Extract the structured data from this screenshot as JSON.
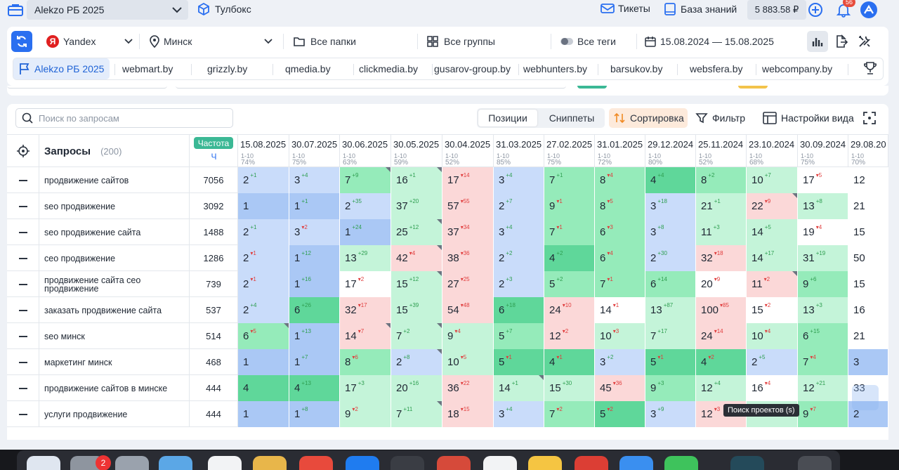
{
  "topbar": {
    "project": "Alekzo РБ 2025",
    "toolbox": "Тулбокс",
    "tickets": "Тикеты",
    "knowledge_base": "База знаний",
    "balance": "5 883.58 ₽",
    "notif_count": "56"
  },
  "filters": {
    "engine": "Yandex",
    "engine_letter": "Я",
    "region": "Минск",
    "folders": "Все папки",
    "groups": "Все группы",
    "tags": "Все теги",
    "date_range": "15.08.2024 — 15.08.2025"
  },
  "project_tabs": [
    "Alekzo РБ 2025",
    "webmart.by",
    "grizzly.by",
    "qmedia.by",
    "clickmedia.by",
    "gusarov-group.by",
    "webhunters.by",
    "barsukov.by",
    "websfera.by",
    "webcompany.by"
  ],
  "toolbar": {
    "search_placeholder": "Поиск по запросам",
    "positions": "Позиции",
    "snippets": "Сниппеты",
    "sort": "Сортировка",
    "filter": "Фильтр",
    "view_settings": "Настройки вида"
  },
  "table": {
    "queries_label": "Запросы",
    "queries_count": "(200)",
    "freq_label": "Частота",
    "freq_sub": "Ч",
    "dates": [
      {
        "date": "15.08.2025",
        "range": "1-10",
        "pct": "74%"
      },
      {
        "date": "30.07.2025",
        "range": "1-10",
        "pct": "75%"
      },
      {
        "date": "30.06.2025",
        "range": "1-10",
        "pct": "63%"
      },
      {
        "date": "30.05.2025",
        "range": "1-10",
        "pct": "59%"
      },
      {
        "date": "30.04.2025",
        "range": "1-10",
        "pct": "52%"
      },
      {
        "date": "31.03.2025",
        "range": "1-10",
        "pct": "85%"
      },
      {
        "date": "27.02.2025",
        "range": "1-10",
        "pct": "75%"
      },
      {
        "date": "31.01.2025",
        "range": "1-10",
        "pct": "72%"
      },
      {
        "date": "29.12.2024",
        "range": "1-10",
        "pct": "80%"
      },
      {
        "date": "25.11.2024",
        "range": "1-10",
        "pct": "52%"
      },
      {
        "date": "23.10.2024",
        "range": "1-10",
        "pct": "68%"
      },
      {
        "date": "30.09.2024",
        "range": "1-10",
        "pct": "75%"
      },
      {
        "date": "29.08.20",
        "range": "1-10",
        "pct": "70%"
      }
    ],
    "rows": [
      {
        "q": "продвижение сайтов",
        "f": "7056",
        "cells": [
          [
            "2",
            "+1",
            "b1"
          ],
          [
            "3",
            "+4",
            "b1"
          ],
          [
            "7",
            "+9",
            "b3"
          ],
          [
            "16",
            "+1",
            "b4"
          ],
          [
            "17",
            "-14",
            "b5"
          ],
          [
            "3",
            "+4",
            "b1"
          ],
          [
            "7",
            "+1",
            "b3"
          ],
          [
            "8",
            "-4",
            "b3"
          ],
          [
            "4",
            "+4",
            "b2"
          ],
          [
            "8",
            "+2",
            "b3"
          ],
          [
            "10",
            "+7",
            "b4"
          ],
          [
            "17",
            "-5",
            "b6"
          ],
          [
            "12",
            "",
            "b6"
          ]
        ]
      },
      {
        "q": "seo продвижение",
        "f": "3092",
        "cells": [
          [
            "1",
            "",
            "b0"
          ],
          [
            "1",
            "+1",
            "b0"
          ],
          [
            "2",
            "+35",
            "b1"
          ],
          [
            "37",
            "+20",
            "b4"
          ],
          [
            "57",
            "-55",
            "b5"
          ],
          [
            "2",
            "+7",
            "b1"
          ],
          [
            "9",
            "-1",
            "b3"
          ],
          [
            "8",
            "-5",
            "b3"
          ],
          [
            "3",
            "+18",
            "b1"
          ],
          [
            "21",
            "+1",
            "b4"
          ],
          [
            "22",
            "-9",
            "b5"
          ],
          [
            "13",
            "+8",
            "b4"
          ],
          [
            "21",
            "",
            "b6"
          ]
        ]
      },
      {
        "q": "seo продвижение сайта",
        "f": "1488",
        "cells": [
          [
            "2",
            "+1",
            "b1"
          ],
          [
            "3",
            "-2",
            "b1"
          ],
          [
            "1",
            "+24",
            "b0"
          ],
          [
            "25",
            "+12",
            "b4"
          ],
          [
            "37",
            "-34",
            "b5"
          ],
          [
            "3",
            "+4",
            "b1"
          ],
          [
            "7",
            "-1",
            "b3"
          ],
          [
            "6",
            "-3",
            "b3"
          ],
          [
            "3",
            "+8",
            "b1"
          ],
          [
            "11",
            "+3",
            "b4"
          ],
          [
            "14",
            "+5",
            "b4"
          ],
          [
            "19",
            "-4",
            "b6"
          ],
          [
            "15",
            "",
            "b6"
          ]
        ]
      },
      {
        "q": "сео продвижение",
        "f": "1286",
        "cells": [
          [
            "2",
            "-1",
            "b1"
          ],
          [
            "1",
            "+12",
            "b0"
          ],
          [
            "13",
            "+29",
            "b4"
          ],
          [
            "42",
            "-4",
            "b5"
          ],
          [
            "38",
            "-36",
            "b5"
          ],
          [
            "2",
            "+2",
            "b1"
          ],
          [
            "4",
            "+2",
            "b2"
          ],
          [
            "6",
            "-4",
            "b3"
          ],
          [
            "2",
            "+30",
            "b1"
          ],
          [
            "32",
            "-18",
            "b5"
          ],
          [
            "14",
            "+17",
            "b4"
          ],
          [
            "31",
            "+19",
            "b4"
          ],
          [
            "50",
            "",
            "b6"
          ]
        ]
      },
      {
        "q": "продвижение сайта сео продвижение",
        "f": "739",
        "cells": [
          [
            "2",
            "-1",
            "b1"
          ],
          [
            "1",
            "+16",
            "b0"
          ],
          [
            "17",
            "-2",
            "b6"
          ],
          [
            "15",
            "+12",
            "b4"
          ],
          [
            "27",
            "-25",
            "b5"
          ],
          [
            "2",
            "+3",
            "b1"
          ],
          [
            "5",
            "+2",
            "b3"
          ],
          [
            "7",
            "-1",
            "b3"
          ],
          [
            "6",
            "+14",
            "b3"
          ],
          [
            "20",
            "-9",
            "b6"
          ],
          [
            "11",
            "-2",
            "b5"
          ],
          [
            "9",
            "+6",
            "b3"
          ],
          [
            "15",
            "",
            "b6"
          ]
        ]
      },
      {
        "q": "заказать продвижение сайта",
        "f": "537",
        "cells": [
          [
            "2",
            "+4",
            "b1"
          ],
          [
            "6",
            "+26",
            "b2"
          ],
          [
            "32",
            "-17",
            "b5"
          ],
          [
            "15",
            "+39",
            "b4"
          ],
          [
            "54",
            "-48",
            "b5"
          ],
          [
            "6",
            "+18",
            "b2"
          ],
          [
            "24",
            "-10",
            "b5"
          ],
          [
            "14",
            "-1",
            "b6"
          ],
          [
            "13",
            "+87",
            "b4"
          ],
          [
            "100",
            "-85",
            "b5"
          ],
          [
            "15",
            "-2",
            "b6"
          ],
          [
            "13",
            "+3",
            "b4"
          ],
          [
            "16",
            "",
            "b6"
          ]
        ]
      },
      {
        "q": "seo минск",
        "f": "514",
        "cells": [
          [
            "6",
            "-5",
            "b3"
          ],
          [
            "1",
            "+13",
            "b0"
          ],
          [
            "14",
            "-7",
            "b5"
          ],
          [
            "7",
            "+2",
            "b4"
          ],
          [
            "9",
            "-4",
            "b4"
          ],
          [
            "5",
            "+7",
            "b3"
          ],
          [
            "12",
            "-2",
            "b5"
          ],
          [
            "10",
            "-3",
            "b4"
          ],
          [
            "7",
            "+17",
            "b4"
          ],
          [
            "24",
            "-14",
            "b5"
          ],
          [
            "10",
            "-4",
            "b4"
          ],
          [
            "6",
            "+15",
            "b3"
          ],
          [
            "21",
            "",
            "b6"
          ]
        ]
      },
      {
        "q": "маркетинг минск",
        "f": "468",
        "cells": [
          [
            "1",
            "",
            "b0"
          ],
          [
            "1",
            "+7",
            "b0"
          ],
          [
            "8",
            "-6",
            "b3"
          ],
          [
            "2",
            "+8",
            "b1"
          ],
          [
            "10",
            "-5",
            "b4"
          ],
          [
            "5",
            "-1",
            "b2"
          ],
          [
            "4",
            "-1",
            "b2"
          ],
          [
            "3",
            "+2",
            "b1"
          ],
          [
            "5",
            "-1",
            "b2"
          ],
          [
            "4",
            "-2",
            "b2"
          ],
          [
            "2",
            "+5",
            "b1"
          ],
          [
            "7",
            "-4",
            "b3"
          ],
          [
            "3",
            "",
            "b0"
          ]
        ]
      },
      {
        "q": "продвижение сайтов в минске",
        "f": "444",
        "cells": [
          [
            "4",
            "",
            "b2"
          ],
          [
            "4",
            "+13",
            "b2"
          ],
          [
            "17",
            "+3",
            "b4"
          ],
          [
            "20",
            "+16",
            "b4"
          ],
          [
            "36",
            "-22",
            "b5"
          ],
          [
            "14",
            "+1",
            "b4"
          ],
          [
            "15",
            "+30",
            "b4"
          ],
          [
            "45",
            "-36",
            "b5"
          ],
          [
            "9",
            "+3",
            "b3"
          ],
          [
            "12",
            "+4",
            "b4"
          ],
          [
            "16",
            "-4",
            "b6"
          ],
          [
            "12",
            "+21",
            "b4"
          ],
          [
            "33",
            "",
            "b6"
          ]
        ]
      },
      {
        "q": "услуги продвижение",
        "f": "444",
        "cells": [
          [
            "1",
            "",
            "b0"
          ],
          [
            "1",
            "+8",
            "b0"
          ],
          [
            "9",
            "-2",
            "b4"
          ],
          [
            "7",
            "+11",
            "b4"
          ],
          [
            "18",
            "-15",
            "b5"
          ],
          [
            "3",
            "+4",
            "b1"
          ],
          [
            "7",
            "-2",
            "b3"
          ],
          [
            "5",
            "-2",
            "b2"
          ],
          [
            "3",
            "+9",
            "b1"
          ],
          [
            "12",
            "-3",
            "b5"
          ],
          [
            "",
            "",
            "b4"
          ],
          [
            "9",
            "-7",
            "b3"
          ],
          [
            "2",
            "",
            "b0"
          ]
        ]
      }
    ]
  },
  "tooltip": "Поиск проектов (s)",
  "dock": {
    "badge": "2"
  }
}
